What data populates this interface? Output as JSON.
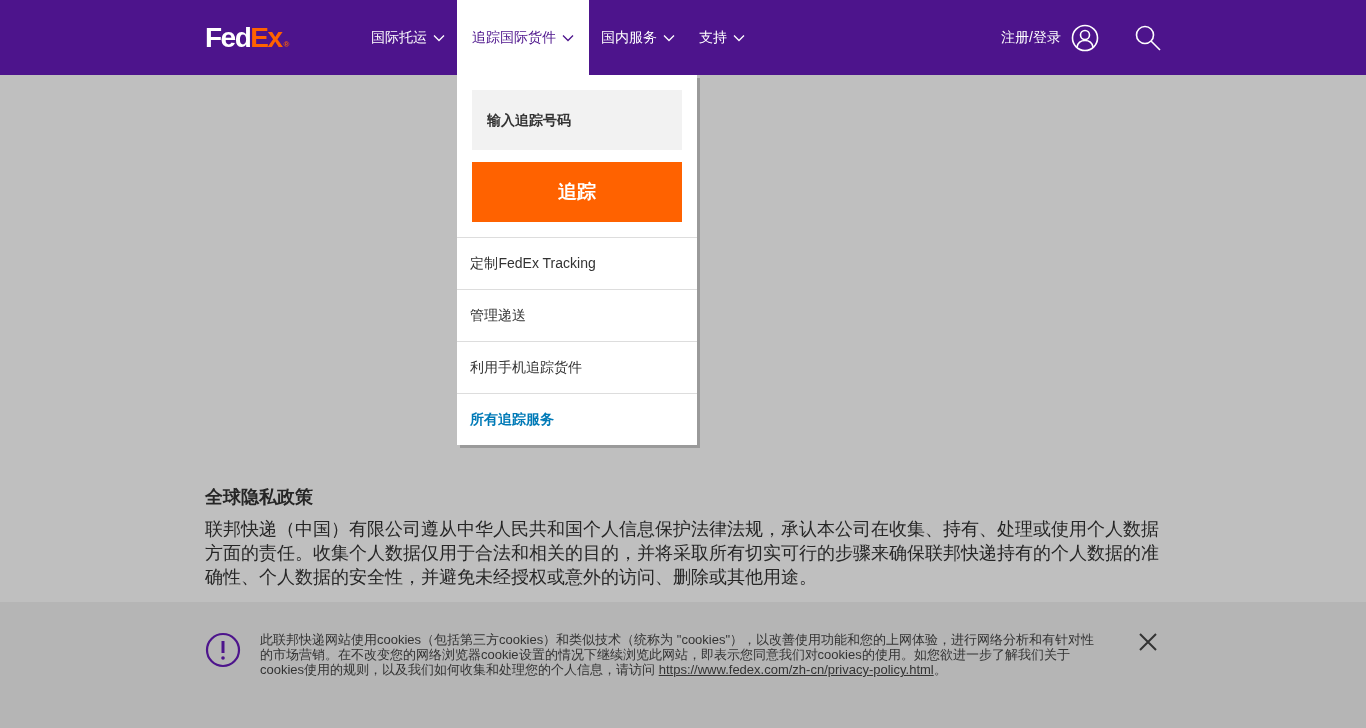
{
  "header": {
    "logo": {
      "first": "Fed",
      "second": "Ex",
      "mark": "®"
    },
    "nav": [
      {
        "label": "国际托运",
        "selected": false
      },
      {
        "label": "追踪国际货件",
        "selected": true
      },
      {
        "label": "国内服务",
        "selected": false
      },
      {
        "label": "支持",
        "selected": false
      }
    ],
    "account": {
      "label": "注册/登录"
    }
  },
  "tracking_menu": {
    "field": {
      "placeholder": "输入追踪号码"
    },
    "button": "追踪",
    "links": [
      {
        "label": "定制FedEx Tracking",
        "kind": "plain"
      },
      {
        "label": "管理递送",
        "kind": "plain"
      },
      {
        "label": "利用手机追踪货件",
        "kind": "plain"
      },
      {
        "label": "所有追踪服务",
        "kind": "highlight"
      }
    ]
  },
  "content": {
    "heading": "全球隐私政策",
    "paragraph": "联邦快递（中国）有限公司遵从中华人民共和国个人信息保护法律法规，承认本公司在收集、持有、处理或使用个人数据方面的责任。收集个人数据仅用于合法和相关的目的，并将采取所有切实可行的步骤来确保联邦快递持有的个人数据的准确性、个人数据的安全性，并避免未经授权或意外的访问、删除或其他用途。"
  },
  "cookie_banner": {
    "text": "此联邦快递网站使用cookies（包括第三方cookies）和类似技术（统称为 \"cookies\"），以改善使用功能和您的上网体验，进行网络分析和有针对性的市场营销。在不改变您的网络浏览器cookie设置的情况下继续浏览此网站，即表示您同意我们对cookies的使用。如您欲进一步了解我们关于cookies使用的规则，以及我们如何收集和处理您的个人信息，请访问 ",
    "link": "https://www.fedex.com/zh-cn/privacy-policy.html",
    "end": "。"
  }
}
